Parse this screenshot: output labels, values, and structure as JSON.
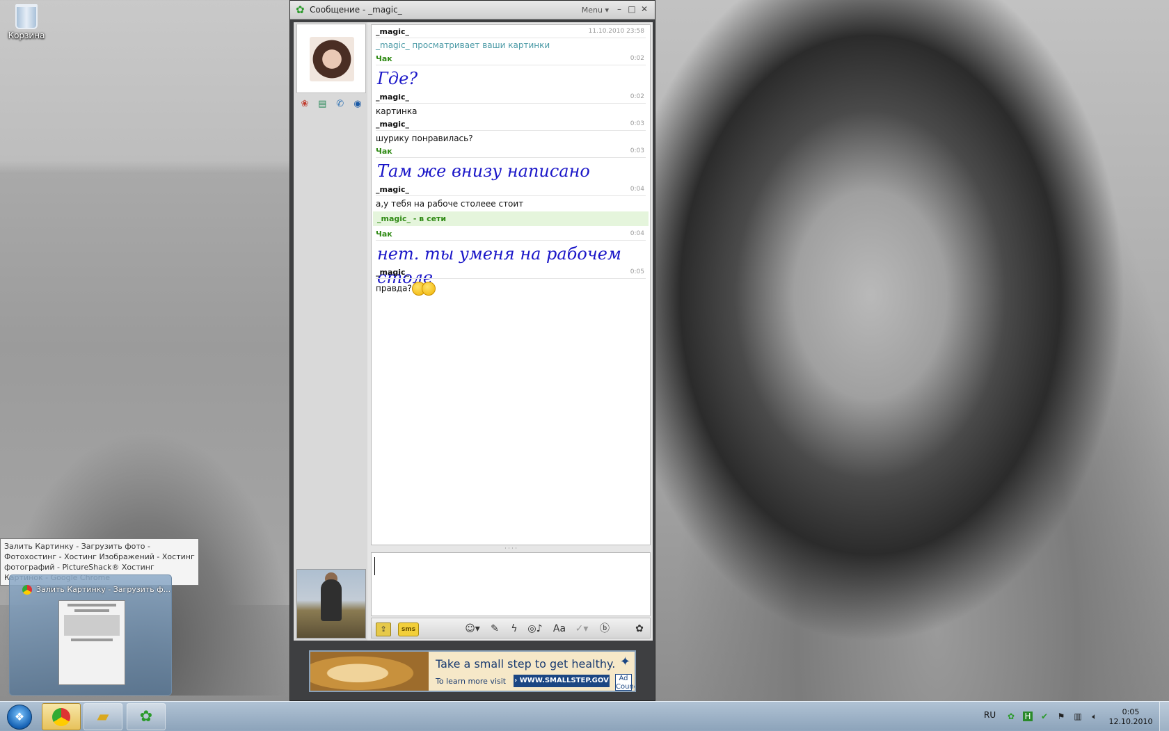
{
  "desktop": {
    "recycle_bin_label": "Корзина"
  },
  "window": {
    "title": "Сообщение - _magic_",
    "menu_label": "Menu ▾",
    "minimize": "–",
    "maximize": "□",
    "close": "✕"
  },
  "chat": {
    "messages": [
      {
        "nick": "_magic_",
        "time": "11.10.2010 23:58"
      },
      {
        "system": "_magic_ просматривает ваши картинки"
      },
      {
        "nick": "Чак",
        "time": "0:02",
        "text": "Где?"
      },
      {
        "nick": "_magic_",
        "time": "0:02",
        "text": "картинка"
      },
      {
        "nick": "_magic_",
        "time": "0:03",
        "text": "шурику понравилась?"
      },
      {
        "nick": "Чак",
        "time": "0:03",
        "text": "Там же внизу написано"
      },
      {
        "nick": "_magic_",
        "time": "0:04",
        "text": "а,у тебя на рабоче столеее стоит"
      },
      {
        "status": "_magic_ - в сети"
      },
      {
        "nick": "Чак",
        "time": "0:04",
        "text": "нет. ты  уменя на рабочем столе"
      },
      {
        "nick": "_magic_",
        "time": "0:05",
        "text": "правда?"
      }
    ]
  },
  "toolbar": {
    "sms_label": "sms"
  },
  "ad": {
    "headline": "Take a small step to get healthy.",
    "subline": "To learn more visit",
    "url": "› WWW.SMALLSTEP.GOV",
    "ad_label": "Ad Council"
  },
  "tooltip": {
    "text": "Залить Картинку - Загрузить фото - Фотохостинг - Хостинг Изображений - Хостинг фотографий - PictureShack® Хостинг Картинок - Google Chrome"
  },
  "thumbnail": {
    "title": "Залить Картинку - Загрузить ф..."
  },
  "taskbar": {
    "language": "RU",
    "time": "0:05",
    "date": "12.10.2010"
  }
}
